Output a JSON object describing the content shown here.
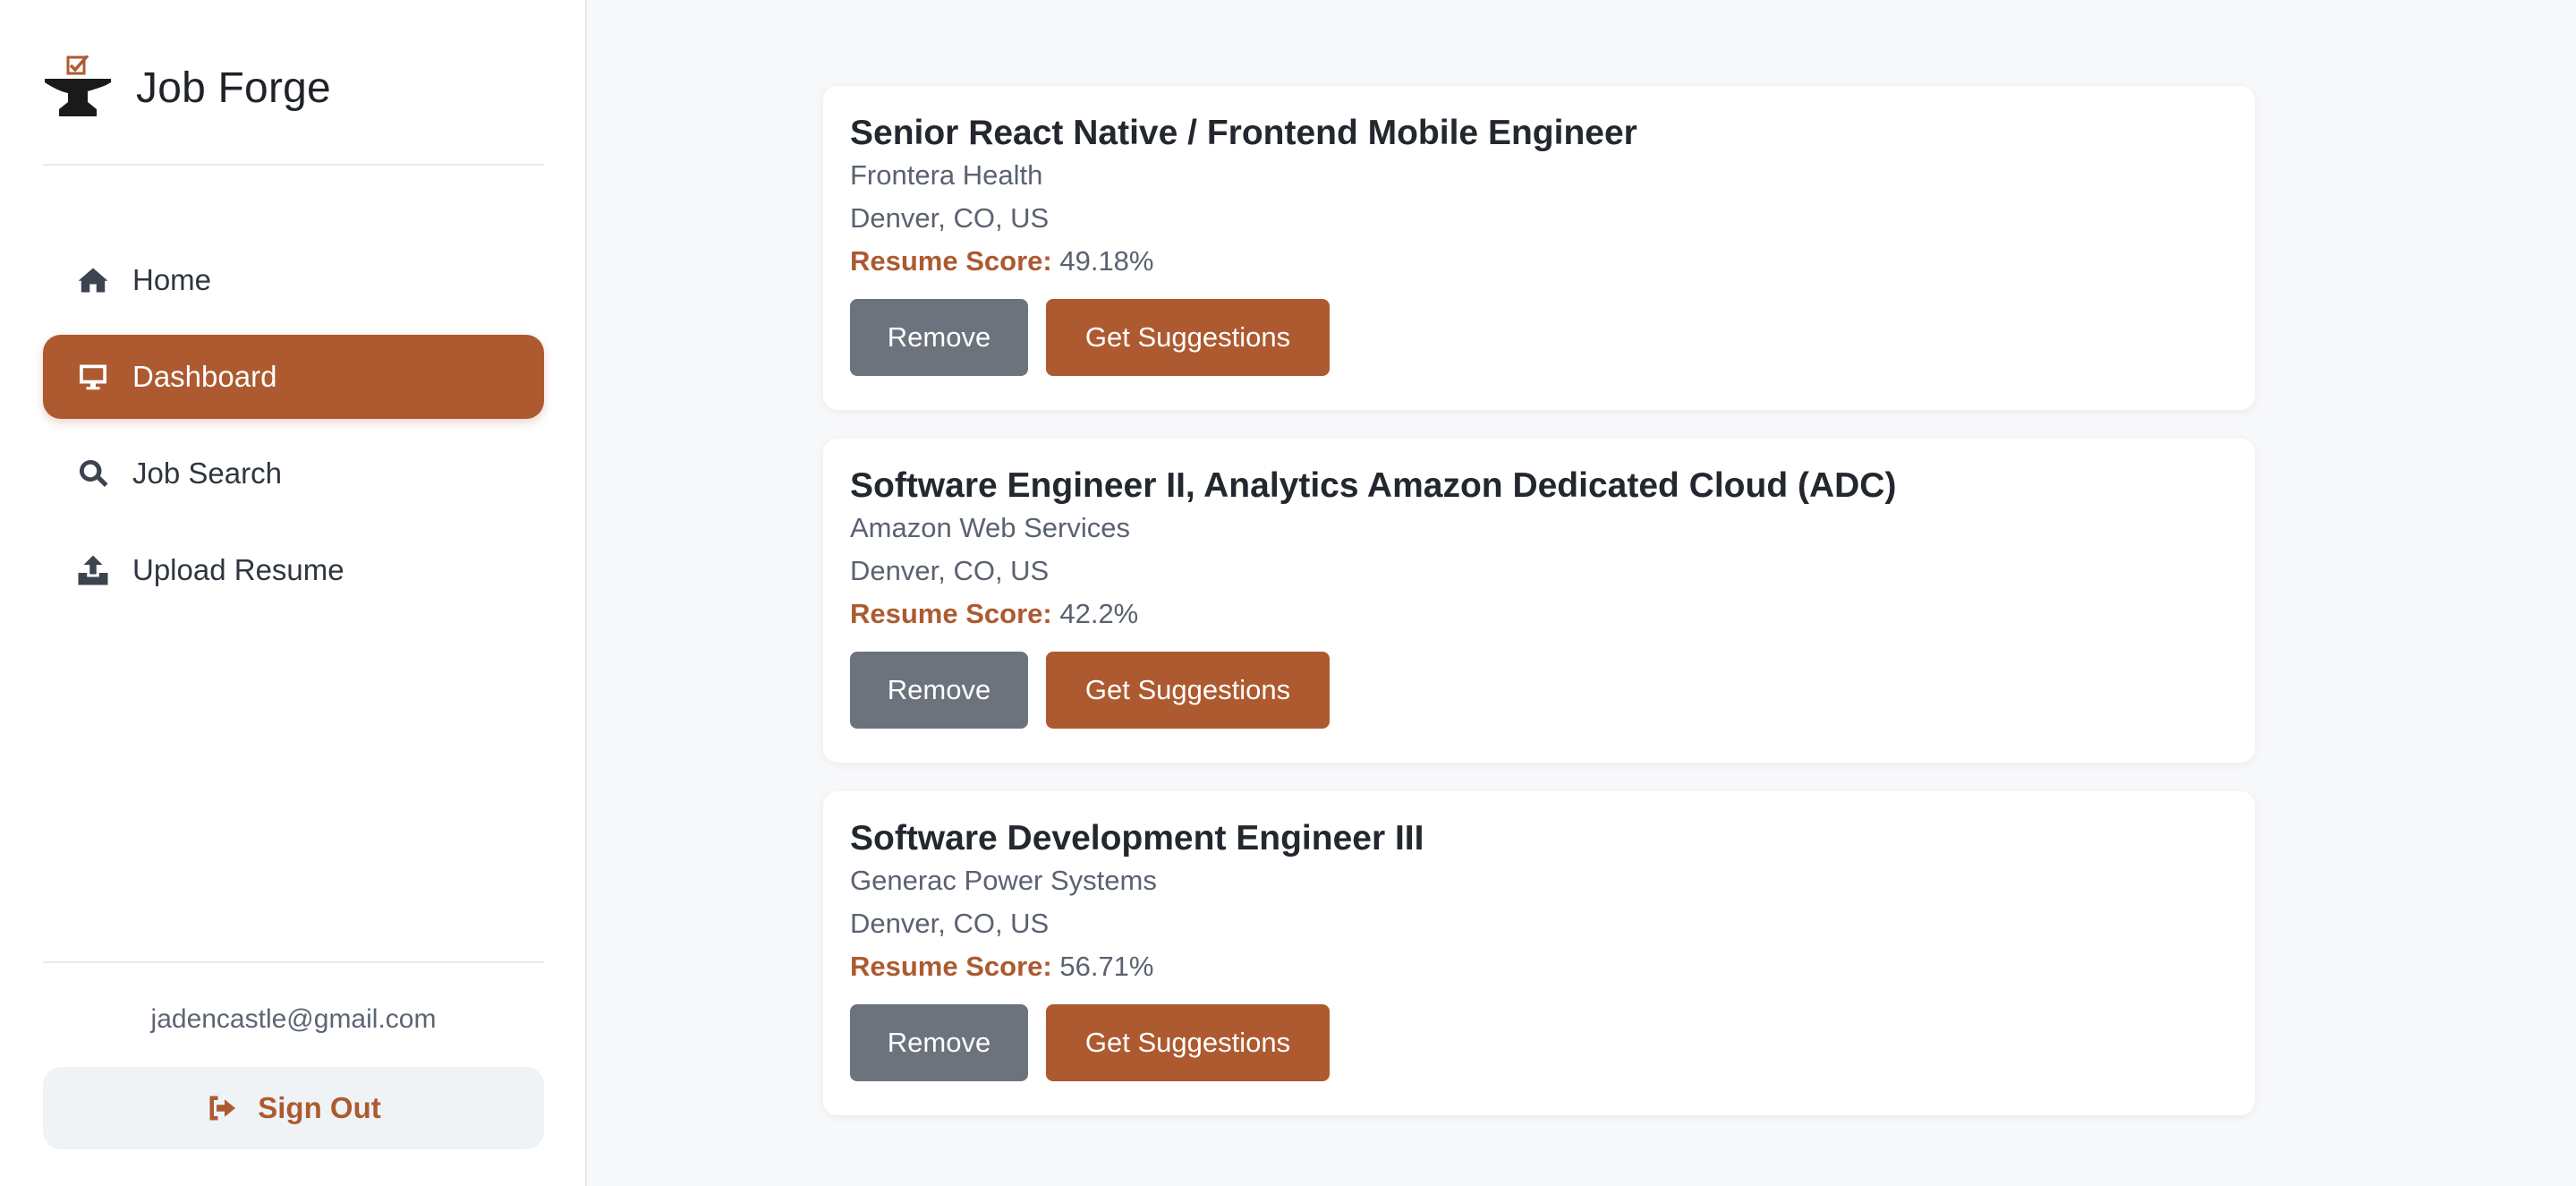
{
  "brand": {
    "title": "Job Forge",
    "logo_icon": "anvil-checkmark-icon"
  },
  "sidebar": {
    "nav": [
      {
        "label": "Home",
        "icon": "home-icon",
        "active": false
      },
      {
        "label": "Dashboard",
        "icon": "monitor-icon",
        "active": true
      },
      {
        "label": "Job Search",
        "icon": "search-icon",
        "active": false
      },
      {
        "label": "Upload Resume",
        "icon": "upload-icon",
        "active": false
      }
    ],
    "user_email": "jadencastle@gmail.com",
    "sign_out_label": "Sign Out"
  },
  "jobs": [
    {
      "title": "Senior React Native / Frontend Mobile Engineer",
      "company": "Frontera Health",
      "location": "Denver, CO, US",
      "score_label": "Resume Score:",
      "score_value": "49.18%",
      "remove_label": "Remove",
      "suggest_label": "Get Suggestions"
    },
    {
      "title": "Software Engineer II, Analytics Amazon Dedicated Cloud (ADC)",
      "company": "Amazon Web Services",
      "location": "Denver, CO, US",
      "score_label": "Resume Score:",
      "score_value": "42.2%",
      "remove_label": "Remove",
      "suggest_label": "Get Suggestions"
    },
    {
      "title": "Software Development Engineer III",
      "company": "Generac Power Systems",
      "location": "Denver, CO, US",
      "score_label": "Resume Score:",
      "score_value": "56.71%",
      "remove_label": "Remove",
      "suggest_label": "Get Suggestions"
    }
  ],
  "colors": {
    "accent": "#ad5a30",
    "remove_button": "#6c737c",
    "sidebar_bg": "#ffffff",
    "main_bg": "#f7f8fa",
    "signout_bg": "#f0f3f6"
  }
}
